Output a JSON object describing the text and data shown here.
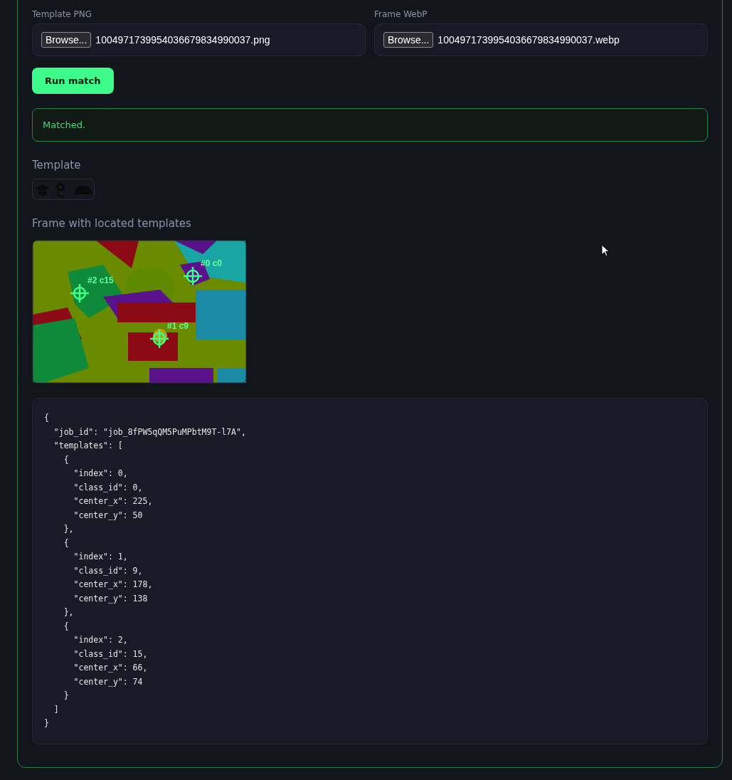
{
  "inputs": [
    {
      "label": "Template PNG",
      "button": "Browse...",
      "filename": "1004971739954036679834990037.png"
    },
    {
      "label": "Frame WebP",
      "button": "Browse...",
      "filename": "1004971739954036679834990037.webp"
    }
  ],
  "run_button": "Run match",
  "status": {
    "kind": "success",
    "message": "Matched."
  },
  "template_heading": "Template",
  "frame_heading": "Frame with located templates",
  "markers": [
    {
      "label": "#0 c0"
    },
    {
      "label": "#1 c9"
    },
    {
      "label": "#2 c15"
    }
  ],
  "code_lines": [
    "{",
    "  \"job_id\": \"job_8fPW5qQM5PuMPbtM9T-l7A\",",
    "  \"templates\": [",
    "    {",
    "      \"index\": 0,",
    "      \"class_id\": 0,",
    "      \"center_x\": 225,",
    "      \"center_y\": 50",
    "    },",
    "    {",
    "      \"index\": 1,",
    "      \"class_id\": 9,",
    "      \"center_x\": 178,",
    "      \"center_y\": 138",
    "    },",
    "    {",
    "      \"index\": 2,",
    "      \"class_id\": 15,",
    "      \"center_x\": 66,",
    "      \"center_y\": 74",
    "    }",
    "  ]",
    "}"
  ]
}
